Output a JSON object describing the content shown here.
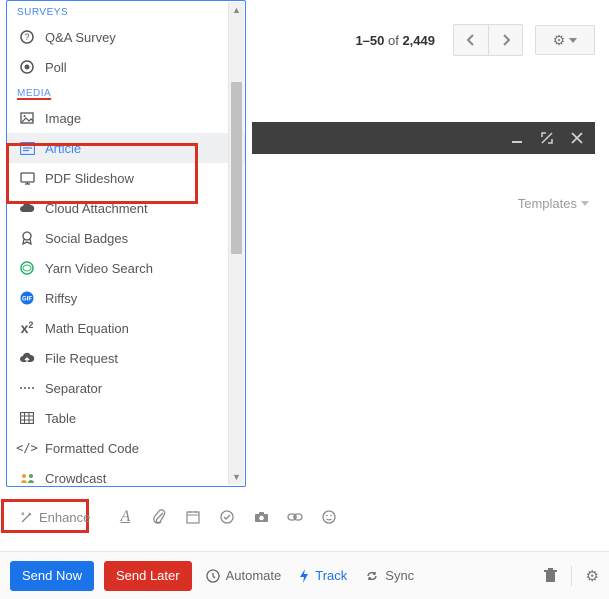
{
  "top": {
    "count_range": "1–50",
    "count_of": "of",
    "count_total": "2,449"
  },
  "templates": {
    "label": "Templates"
  },
  "panel": {
    "groups": {
      "surveys": {
        "label": "SURVEYS",
        "items": [
          "Q&A Survey",
          "Poll"
        ]
      },
      "media": {
        "label": "MEDIA",
        "items": [
          "Image",
          "Article",
          "PDF Slideshow",
          "Cloud Attachment",
          "Social Badges",
          "Yarn Video Search",
          "Riffsy",
          "Math Equation",
          "File Request",
          "Separator",
          "Table",
          "Formatted Code",
          "Crowdcast"
        ]
      }
    },
    "selected": "Article"
  },
  "toolbar": {
    "enhance": "Enhance"
  },
  "actions": {
    "send_now": "Send Now",
    "send_later": "Send Later",
    "automate": "Automate",
    "track": "Track",
    "sync": "Sync"
  }
}
